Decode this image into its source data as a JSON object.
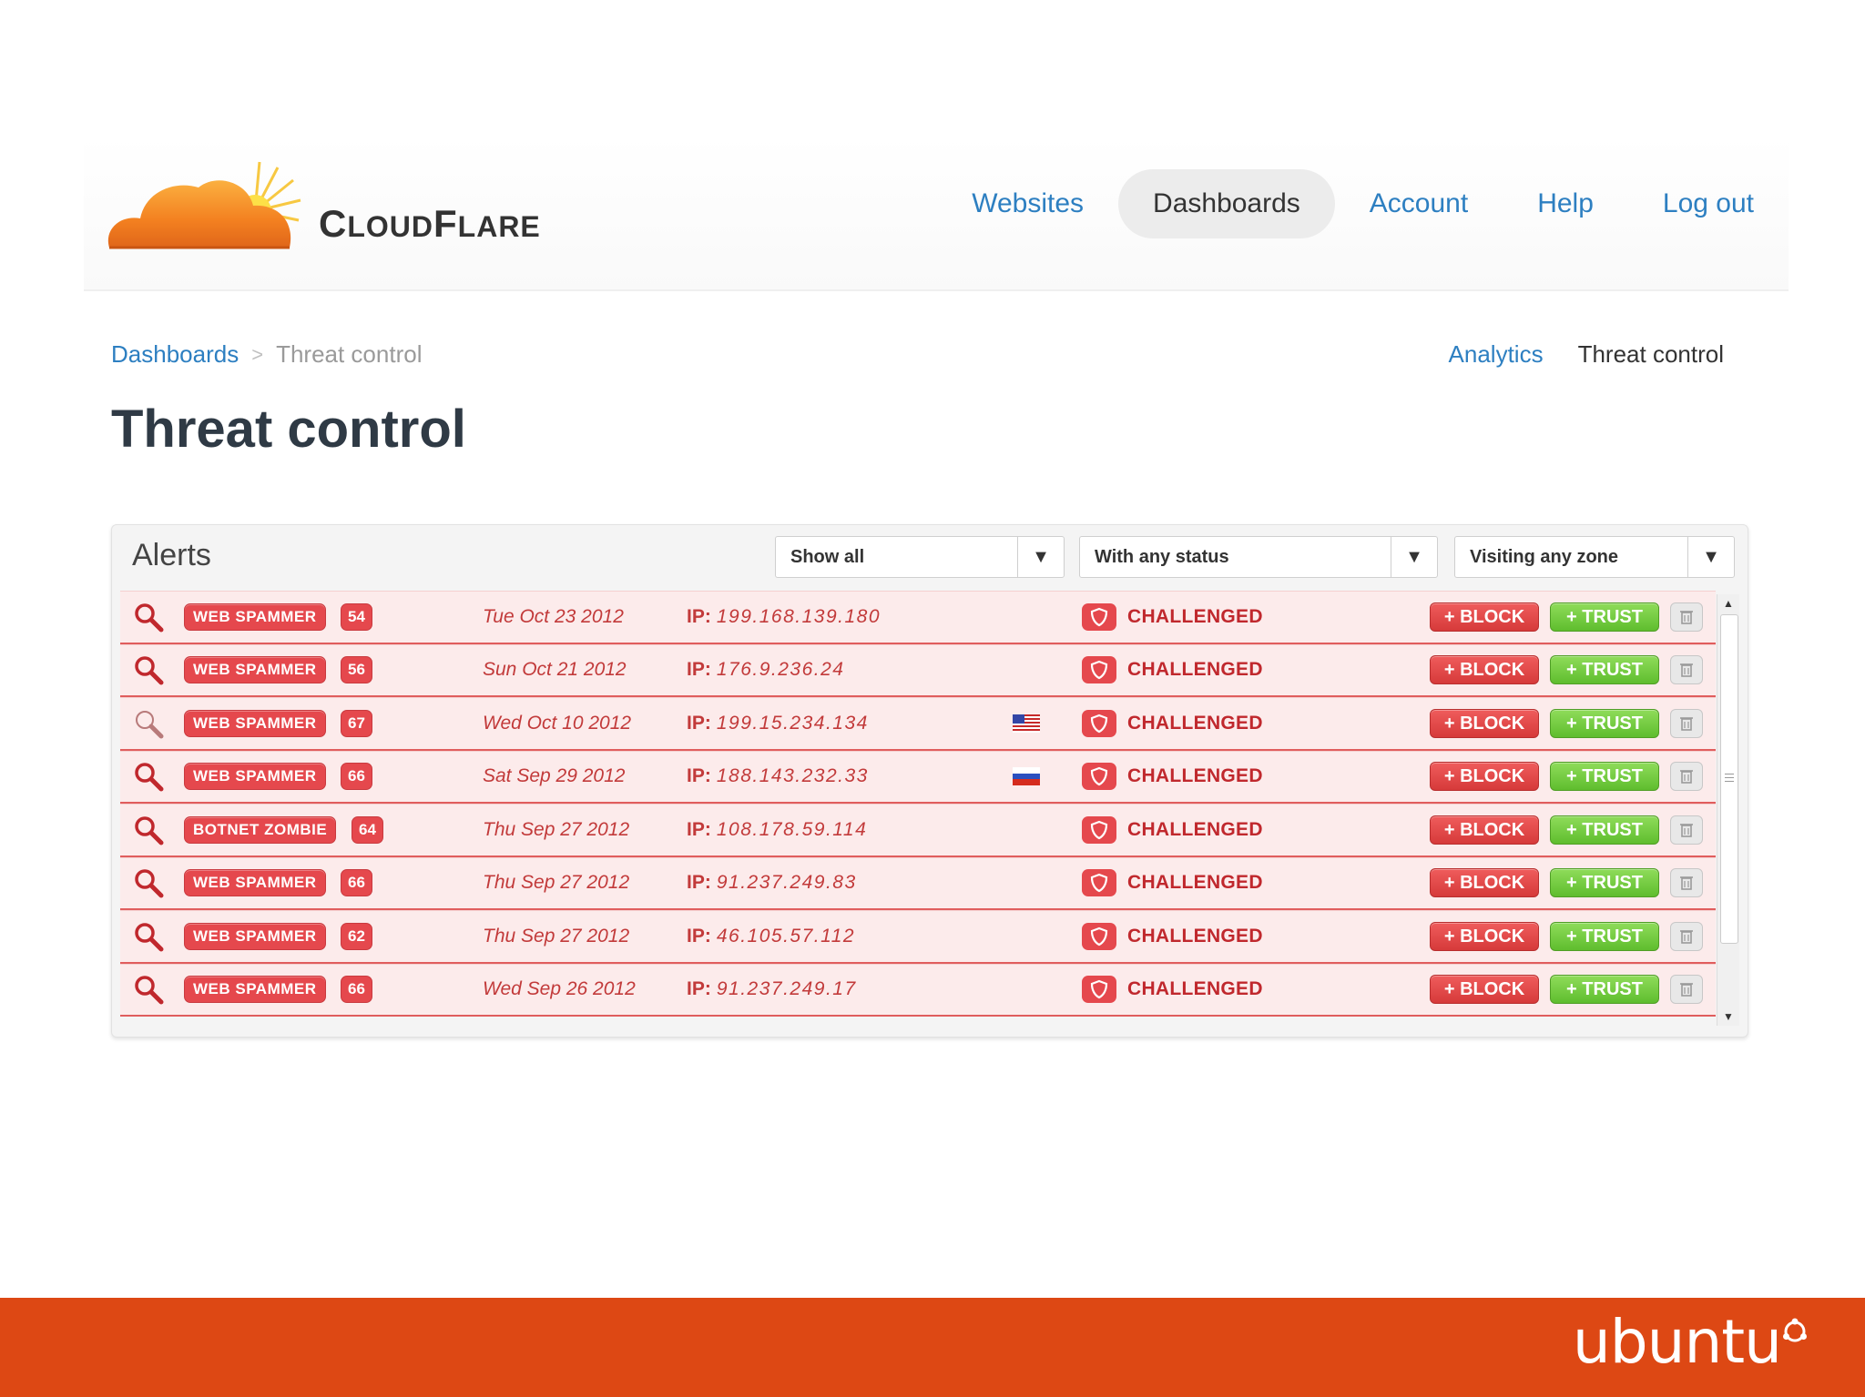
{
  "brand": {
    "name_initial_1": "C",
    "name_rest_1": "LOUD",
    "name_initial_2": "F",
    "name_rest_2": "LARE"
  },
  "nav": {
    "items": [
      {
        "label": "Websites",
        "active": false
      },
      {
        "label": "Dashboards",
        "active": true
      },
      {
        "label": "Account",
        "active": false
      },
      {
        "label": "Help",
        "active": false
      },
      {
        "label": "Log out",
        "active": false
      }
    ]
  },
  "breadcrumb": {
    "parent": "Dashboards",
    "separator": ">",
    "current": "Threat control"
  },
  "subnav": {
    "link": "Analytics",
    "current": "Threat control"
  },
  "page_title": "Threat control",
  "alerts": {
    "title": "Alerts",
    "filters": [
      {
        "label": "Show all",
        "arrow": "▼"
      },
      {
        "label": "With any status",
        "arrow": "▼"
      },
      {
        "label": "Visiting any zone",
        "arrow": "▼"
      }
    ],
    "rows": [
      {
        "tag": "WEB SPAMMER",
        "score": "54",
        "date": "Tue Oct 23 2012",
        "ip_label": "IP:",
        "ip": "199.168.139.180",
        "flag": "",
        "status": "CHALLENGED",
        "block": "+ BLOCK",
        "trust": "+ TRUST"
      },
      {
        "tag": "WEB SPAMMER",
        "score": "56",
        "date": "Sun Oct 21 2012",
        "ip_label": "IP:",
        "ip": "176.9.236.24",
        "flag": "",
        "status": "CHALLENGED",
        "block": "+ BLOCK",
        "trust": "+ TRUST"
      },
      {
        "tag": "WEB SPAMMER",
        "score": "67",
        "date": "Wed Oct 10 2012",
        "ip_label": "IP:",
        "ip": "199.15.234.134",
        "flag": "us-flag-icon",
        "status": "CHALLENGED",
        "block": "+ BLOCK",
        "trust": "+ TRUST"
      },
      {
        "tag": "WEB SPAMMER",
        "score": "66",
        "date": "Sat Sep 29 2012",
        "ip_label": "IP:",
        "ip": "188.143.232.33",
        "flag": "ru-flag-icon",
        "status": "CHALLENGED",
        "block": "+ BLOCK",
        "trust": "+ TRUST"
      },
      {
        "tag": "BOTNET ZOMBIE",
        "score": "64",
        "date": "Thu Sep 27 2012",
        "ip_label": "IP:",
        "ip": "108.178.59.114",
        "flag": "",
        "status": "CHALLENGED",
        "block": "+ BLOCK",
        "trust": "+ TRUST"
      },
      {
        "tag": "WEB SPAMMER",
        "score": "66",
        "date": "Thu Sep 27 2012",
        "ip_label": "IP:",
        "ip": "91.237.249.83",
        "flag": "",
        "status": "CHALLENGED",
        "block": "+ BLOCK",
        "trust": "+ TRUST"
      },
      {
        "tag": "WEB SPAMMER",
        "score": "62",
        "date": "Thu Sep 27 2012",
        "ip_label": "IP:",
        "ip": "46.105.57.112",
        "flag": "",
        "status": "CHALLENGED",
        "block": "+ BLOCK",
        "trust": "+ TRUST"
      },
      {
        "tag": "WEB SPAMMER",
        "score": "66",
        "date": "Wed Sep 26 2012",
        "ip_label": "IP:",
        "ip": "91.237.249.17",
        "flag": "",
        "status": "CHALLENGED",
        "block": "+ BLOCK",
        "trust": "+ TRUST"
      }
    ],
    "scroll_up": "▲",
    "scroll_down": "▼"
  },
  "footer": {
    "word": "ubuntu"
  },
  "colors": {
    "link": "#2d7fc1",
    "alert_red": "#e5484d",
    "trust_green": "#5fbd2e",
    "row_bg": "#fcebeb",
    "footer_orange": "#dd4814",
    "logo_orange": "#f38020"
  }
}
